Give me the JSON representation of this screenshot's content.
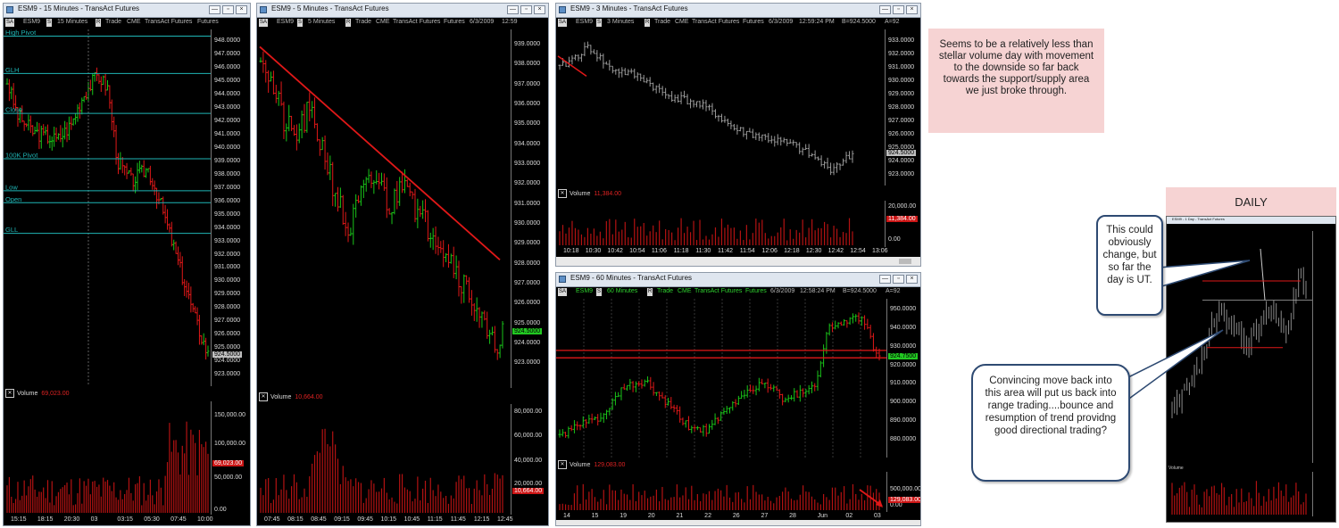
{
  "window_controls": {
    "minimize": "—",
    "restore": "▫",
    "close": "×"
  },
  "w15": {
    "title": "ESM9 - 15 Minutes - TransAct Futures",
    "toolbar": [
      "SA",
      "ESM9",
      "S",
      "15 Minutes",
      "R",
      "Trade",
      "CME",
      "TransAct Futures",
      "Futures"
    ],
    "levels": [
      {
        "label": "High Pivot",
        "price": 948.4
      },
      {
        "label": "GLH",
        "price": 945.6
      },
      {
        "label": "Close",
        "price": 942.6
      },
      {
        "label": "100K Pivot",
        "price": 939.2
      },
      {
        "label": "Low",
        "price": 936.8
      },
      {
        "label": "Open",
        "price": 935.9
      },
      {
        "label": "GLL",
        "price": 933.6
      }
    ],
    "price_ticks": [
      "948.0000",
      "947.0000",
      "946.0000",
      "945.0000",
      "944.0000",
      "943.0000",
      "942.0000",
      "941.0000",
      "940.0000",
      "939.0000",
      "938.0000",
      "937.0000",
      "936.0000",
      "935.0000",
      "934.0000",
      "933.0000",
      "932.0000",
      "931.0000",
      "930.0000",
      "929.0000",
      "928.0000",
      "927.0000",
      "926.0000",
      "925.0000",
      "924.0000",
      "923.0000"
    ],
    "last_price": "924.5000",
    "volume_label": "Volume",
    "volume_value": "69,023.00",
    "volume_ticks": [
      "150,000.00",
      "100,000.00",
      "50,000.00",
      "0.00"
    ],
    "time_ticks": [
      "15:15",
      "18:15",
      "20:30",
      "03",
      "03:15",
      "05:30",
      "07:45",
      "10:00"
    ]
  },
  "w5": {
    "title": "ESM9 - 5 Minutes - TransAct Futures",
    "toolbar": [
      "SA",
      "ESM9",
      "S",
      "5 Minutes",
      "R",
      "Trade",
      "CME",
      "TransAct Futures",
      "Futures",
      "6/3/2009",
      "12:59"
    ],
    "price_ticks": [
      "939.0000",
      "938.0000",
      "937.0000",
      "936.0000",
      "935.0000",
      "934.0000",
      "933.0000",
      "932.0000",
      "931.0000",
      "930.0000",
      "929.0000",
      "928.0000",
      "927.0000",
      "926.0000",
      "925.0000",
      "924.0000",
      "923.0000"
    ],
    "last_price": "924.5000",
    "volume_label": "Volume",
    "volume_value": "10,664.00",
    "volume_ticks": [
      "80,000.00",
      "60,000.00",
      "40,000.00",
      "20,000.00"
    ],
    "volume_last": "10,664.00",
    "time_ticks": [
      "07:45",
      "08:15",
      "08:45",
      "09:15",
      "09:45",
      "10:15",
      "10:45",
      "11:15",
      "11:45",
      "12:15",
      "12:45"
    ]
  },
  "w3": {
    "title": "ESM9 - 3 Minutes - TransAct Futures",
    "toolbar": [
      "SA",
      "ESM9",
      "S",
      "3 Minutes",
      "R",
      "Trade",
      "CME",
      "TransAct Futures",
      "Futures",
      "6/3/2009",
      "12:59:24 PM",
      "B=924.5000",
      "A=92"
    ],
    "price_ticks": [
      "933.0000",
      "932.0000",
      "931.0000",
      "930.0000",
      "929.0000",
      "928.0000",
      "927.0000",
      "926.0000",
      "925.0000",
      "924.0000",
      "923.0000"
    ],
    "last_price": "924.5000",
    "volume_label": "Volume",
    "volume_value": "11,384.00",
    "volume_ticks": [
      "20,000.00",
      "0.00"
    ],
    "volume_last": "11,384.00",
    "time_ticks": [
      "10:18",
      "10:30",
      "10:42",
      "10:54",
      "11:06",
      "11:18",
      "11:30",
      "11:42",
      "11:54",
      "12:06",
      "12:18",
      "12:30",
      "12:42",
      "12:54",
      "13:06"
    ]
  },
  "w60": {
    "title": "ESM9 - 60 Minutes - TransAct Futures",
    "toolbar": [
      "SA",
      "ESM9",
      "S",
      "60 Minutes",
      "R",
      "Trade",
      "CME",
      "TransAct Futures",
      "Futures",
      "6/3/2009",
      "12:58:24 PM",
      "B=924.5000",
      "A=92"
    ],
    "price_ticks": [
      "950.0000",
      "940.0000",
      "930.0000",
      "920.0000",
      "910.0000",
      "900.0000",
      "890.0000",
      "880.0000"
    ],
    "last_price": "924.7500",
    "volume_label": "Volume",
    "volume_value": "129,083.00",
    "volume_ticks": [
      "500,000.00",
      "0.00"
    ],
    "volume_last": "129,083.00",
    "time_ticks": [
      "14",
      "15",
      "19",
      "20",
      "21",
      "22",
      "26",
      "27",
      "28",
      "Jun",
      "02",
      "03"
    ]
  },
  "note": "Seems to be a relatively less than stellar volume day with movement to the downside so far back towards the support/supply area we just broke through.",
  "daily": {
    "header": "DAILY",
    "mini_title": "ESM9 - 1 Day - TransAct Futures",
    "volume_label": "Volume"
  },
  "callout1": "This could obviously change, but so far the day is UT.",
  "callout2": "Convincing move back into this area will put us back into range trading....bounce and resumption of trend providng good directional trading?",
  "colors": {
    "up": "#19c419",
    "down": "#e01818",
    "level": "#1fb5b5",
    "trend": "#e01818",
    "neutral": "#9a9a9a",
    "volume": "#b31212"
  }
}
